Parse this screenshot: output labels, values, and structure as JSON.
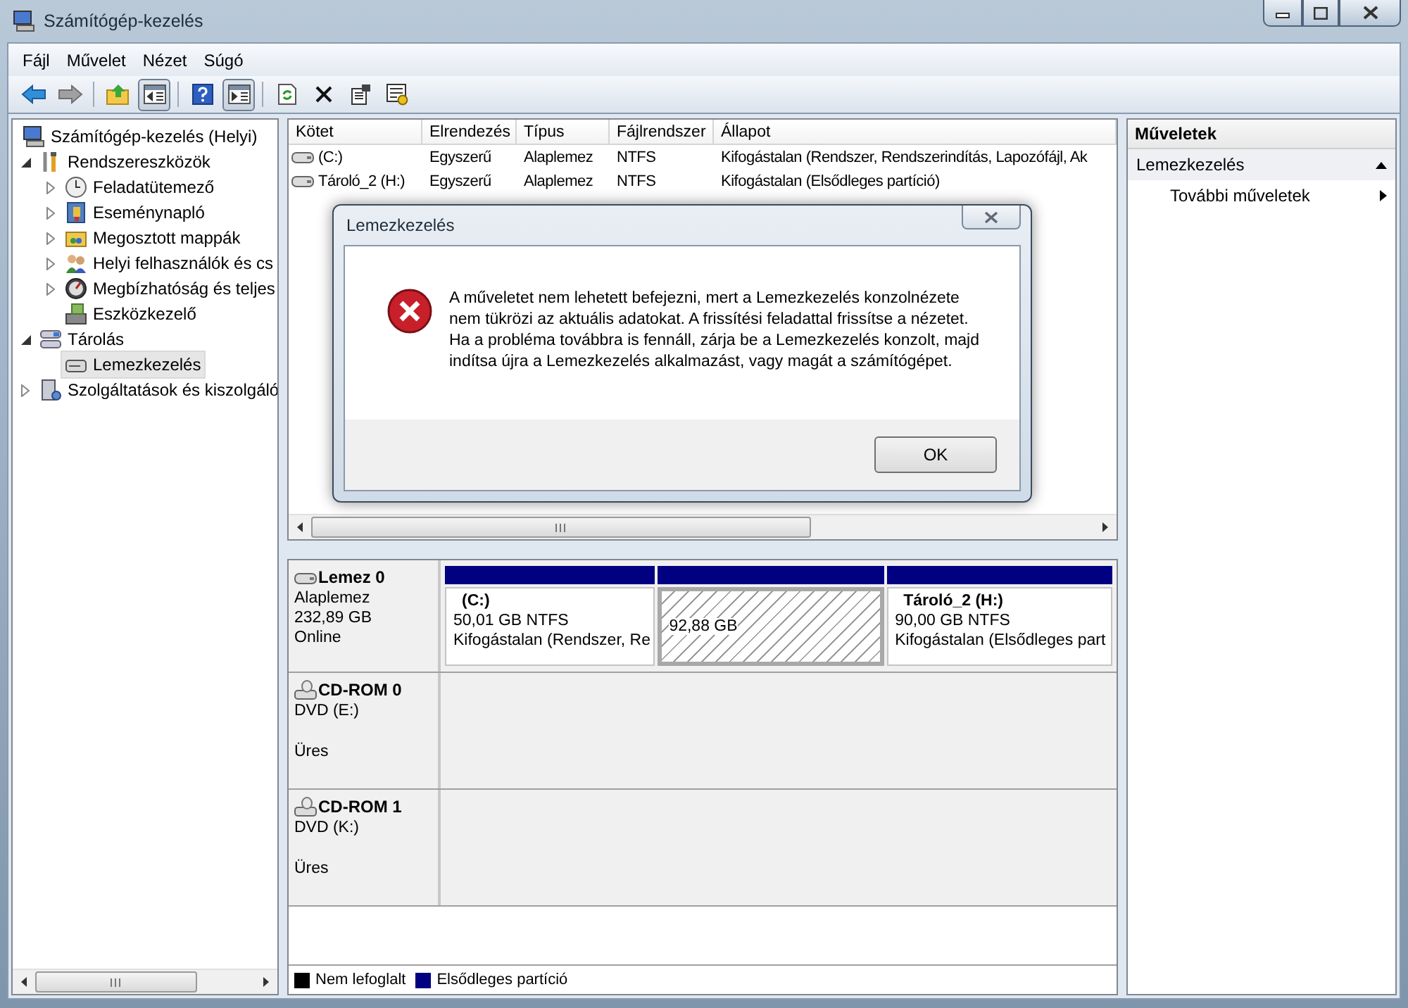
{
  "window": {
    "title": "Számítógép-kezelés"
  },
  "menu": [
    {
      "label": "Fájl"
    },
    {
      "label": "Művelet"
    },
    {
      "label": "Nézet"
    },
    {
      "label": "Súgó"
    }
  ],
  "toolbar": [
    {
      "kind": "back",
      "pressed": false
    },
    {
      "kind": "forward",
      "pressed": false
    },
    {
      "kind": "sep"
    },
    {
      "kind": "up",
      "pressed": false
    },
    {
      "kind": "tree",
      "pressed": true
    },
    {
      "kind": "sep"
    },
    {
      "kind": "help",
      "pressed": false
    },
    {
      "kind": "actionpane",
      "pressed": true
    },
    {
      "kind": "sep"
    },
    {
      "kind": "refresh",
      "pressed": false
    },
    {
      "kind": "delete",
      "pressed": false
    },
    {
      "kind": "properties",
      "pressed": false
    },
    {
      "kind": "settings",
      "pressed": false
    }
  ],
  "tree": [
    {
      "label": "Számítógép-kezelés (Helyi)",
      "kind": "computer",
      "selected": false,
      "children": [
        {
          "label": "Rendszereszközök",
          "kind": "tools",
          "expanded": true,
          "selected": false,
          "children": [
            {
              "label": "Feladatütemező",
              "kind": "clock",
              "expanded": false,
              "selected": false
            },
            {
              "label": "Eseménynapló",
              "kind": "log",
              "expanded": false,
              "selected": false
            },
            {
              "label": "Megosztott mappák",
              "kind": "share",
              "expanded": false,
              "selected": false
            },
            {
              "label": "Helyi felhasználók és cs",
              "kind": "users",
              "expanded": false,
              "selected": false
            },
            {
              "label": "Megbízhatóság és teljes",
              "kind": "gauge",
              "expanded": false,
              "selected": false
            },
            {
              "label": "Eszközkezelő",
              "kind": "devices",
              "selected": false
            }
          ]
        },
        {
          "label": "Tárolás",
          "kind": "storage",
          "expanded": true,
          "selected": false,
          "children": [
            {
              "label": "Lemezkezelés",
              "kind": "diskmgmt",
              "selected": true
            }
          ]
        },
        {
          "label": "Szolgáltatások és kiszolgáló",
          "kind": "services",
          "expanded": false,
          "selected": false
        }
      ]
    }
  ],
  "volumes": {
    "columns": [
      "Kötet",
      "Elrendezés",
      "Típus",
      "Fájlrendszer",
      "Állapot"
    ],
    "rows": [
      [
        "(C:)",
        "Egyszerű",
        "Alaplemez",
        "NTFS",
        "Kifogástalan (Rendszer, Rendszerindítás, Lapozófájl, Ak"
      ],
      [
        "Tároló_2 (H:)",
        "Egyszerű",
        "Alaplemez",
        "NTFS",
        "Kifogástalan (Elsődleges partíció)"
      ]
    ]
  },
  "disks": [
    {
      "name": "Lemez 0",
      "kind": "disk",
      "lines": [
        "Alaplemez",
        "232,89 GB",
        "Online"
      ],
      "partitions": [
        {
          "kind": "primary",
          "selected": false,
          "title": "(C:)",
          "lines": [
            "50,01 GB NTFS",
            "Kifogástalan (Rendszer, Re"
          ]
        },
        {
          "kind": "unallocated",
          "selected": true,
          "lines": [
            "92,88 GB"
          ]
        },
        {
          "kind": "primary",
          "selected": false,
          "title": "Tároló_2  (H:)",
          "lines": [
            "90,00 GB NTFS",
            "Kifogástalan (Elsődleges part"
          ]
        }
      ]
    },
    {
      "name": "CD-ROM 0",
      "kind": "cdrom",
      "lines": [
        "DVD (E:)"
      ],
      "status": "Üres"
    },
    {
      "name": "CD-ROM 1",
      "kind": "cdrom",
      "lines": [
        "DVD (K:)"
      ],
      "status": "Üres"
    }
  ],
  "legend": [
    {
      "label": "Nem lefoglalt",
      "color": "#000000"
    },
    {
      "label": "Elsődleges partíció",
      "color": "#000080"
    }
  ],
  "actions": {
    "title": "Műveletek",
    "section": {
      "label": "Lemezkezelés",
      "expanded": true
    },
    "items": [
      {
        "label": "További műveletek"
      }
    ]
  },
  "dialog": {
    "title": "Lemezkezelés",
    "message": "A műveletet nem lehetett befejezni, mert a Lemezkezelés konzolnézete nem tükrözi az aktuális adatokat. A frissítési feladattal frissítse a nézetet. Ha a probléma továbbra is fennáll, zárja be a Lemezkezelés konzolt, majd indítsa újra a Lemezkezelés alkalmazást, vagy magát a számítógépet.",
    "button": "OK"
  }
}
